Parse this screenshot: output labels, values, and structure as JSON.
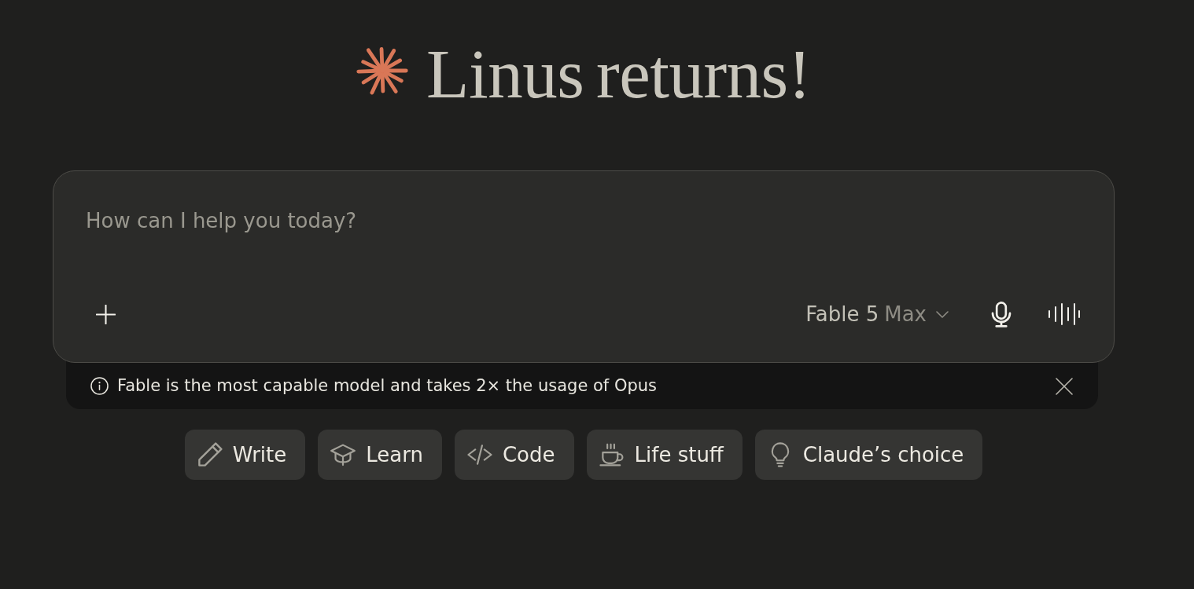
{
  "heading": {
    "title": "Linus returns!"
  },
  "composer": {
    "placeholder": "How can I help you today?",
    "model": "Fable 5",
    "mode": "Max"
  },
  "notice": {
    "text": "Fable is the most capable model and takes 2× the usage of Opus"
  },
  "suggestions": [
    {
      "label": "Write",
      "kind": "write"
    },
    {
      "label": "Learn",
      "kind": "learn"
    },
    {
      "label": "Code",
      "kind": "code"
    },
    {
      "label": "Life stuff",
      "kind": "life"
    },
    {
      "label": "Claude’s choice",
      "kind": "idea"
    }
  ]
}
